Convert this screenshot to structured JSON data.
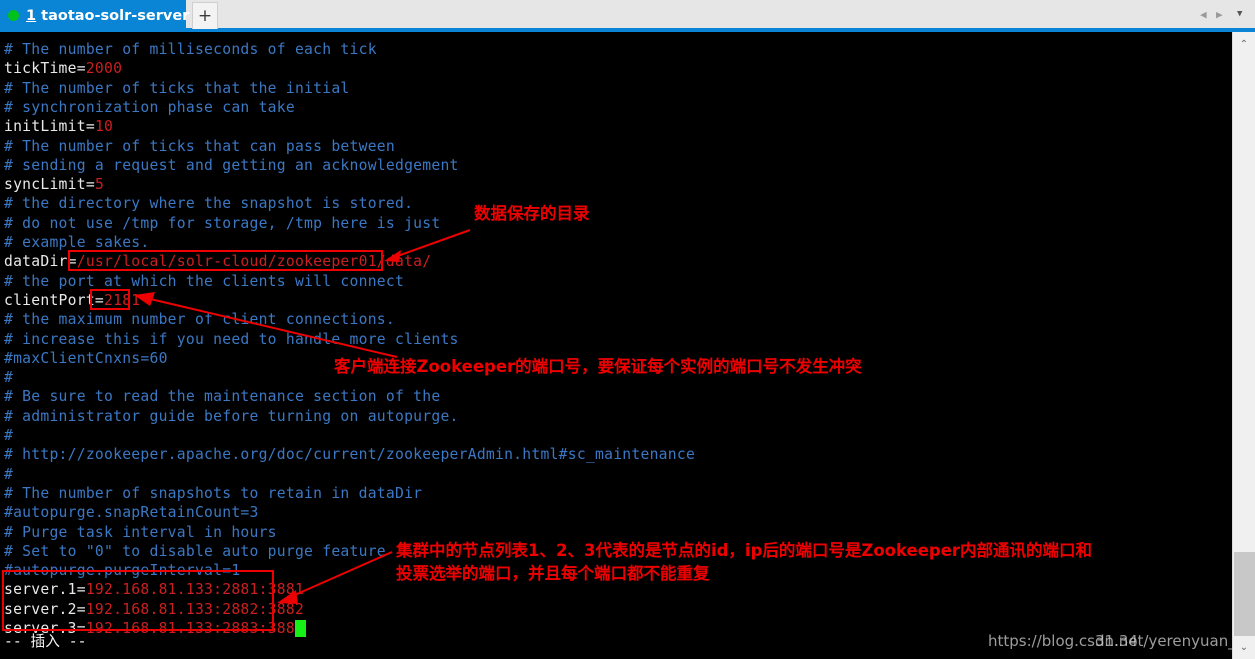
{
  "window": {
    "tab": {
      "index": "1",
      "title": "taotao-solr-server",
      "close_label": "×",
      "status_dot_color": "#00c21c"
    },
    "new_tab_label": "+",
    "controls": {
      "prev": "◀",
      "next": "▶",
      "menu": "▼"
    },
    "accent_color": "#0a84d4"
  },
  "terminal": {
    "background": "#000000",
    "comment_color": "#3b78c4",
    "value_color": "#cc1f1f",
    "text_color": "#e9e9e9",
    "cursor_color": "#16f016",
    "lines": [
      {
        "type": "comment",
        "text": "# The number of milliseconds of each tick"
      },
      {
        "type": "kv",
        "key": "tickTime=",
        "value": "2000"
      },
      {
        "type": "comment",
        "text": "# The number of ticks that the initial"
      },
      {
        "type": "comment",
        "text": "# synchronization phase can take"
      },
      {
        "type": "kv",
        "key": "initLimit=",
        "value": "10"
      },
      {
        "type": "comment",
        "text": "# The number of ticks that can pass between"
      },
      {
        "type": "comment",
        "text": "# sending a request and getting an acknowledgement"
      },
      {
        "type": "kv",
        "key": "syncLimit=",
        "value": "5"
      },
      {
        "type": "comment",
        "text": "# the directory where the snapshot is stored."
      },
      {
        "type": "comment",
        "text": "# do not use /tmp for storage, /tmp here is just"
      },
      {
        "type": "comment",
        "text": "# example sakes."
      },
      {
        "type": "kv",
        "key": "dataDir=",
        "value": "/usr/local/solr-cloud/zookeeper01/data/"
      },
      {
        "type": "comment",
        "text": "# the port at which the clients will connect"
      },
      {
        "type": "kv",
        "key": "clientPort=",
        "value": "2181"
      },
      {
        "type": "comment",
        "text": "# the maximum number of client connections."
      },
      {
        "type": "comment",
        "text": "# increase this if you need to handle more clients"
      },
      {
        "type": "comment",
        "text": "#maxClientCnxns=60"
      },
      {
        "type": "comment",
        "text": "#"
      },
      {
        "type": "comment",
        "text": "# Be sure to read the maintenance section of the"
      },
      {
        "type": "comment",
        "text": "# administrator guide before turning on autopurge."
      },
      {
        "type": "comment",
        "text": "#"
      },
      {
        "type": "comment",
        "text": "# http://zookeeper.apache.org/doc/current/zookeeperAdmin.html#sc_maintenance"
      },
      {
        "type": "comment",
        "text": "#"
      },
      {
        "type": "comment",
        "text": "# The number of snapshots to retain in dataDir"
      },
      {
        "type": "comment",
        "text": "#autopurge.snapRetainCount=3"
      },
      {
        "type": "comment",
        "text": "# Purge task interval in hours"
      },
      {
        "type": "comment",
        "text": "# Set to \"0\" to disable auto purge feature"
      },
      {
        "type": "comment",
        "text": "#autopurge.purgeInterval=1"
      },
      {
        "type": "kv",
        "key": "server.1=",
        "value": "192.168.81.133:2881:3881"
      },
      {
        "type": "kv",
        "key": "server.2=",
        "value": "192.168.81.133:2882:3882"
      },
      {
        "type": "kv",
        "key": "server.3=",
        "value": "192.168.81.133:2883:3883"
      }
    ],
    "status_line": "-- 插入 --"
  },
  "annotations": [
    {
      "id": "datadir-note",
      "text": "数据保存的目录"
    },
    {
      "id": "clientport-note",
      "text": "客户端连接Zookeeper的端口号，要保证每个实例的端口号不发生冲突"
    },
    {
      "id": "servers-note-line1",
      "text": "集群中的节点列表1、2、3代表的是节点的id，ip后的端口号是Zookeeper内部通讯的端口和"
    },
    {
      "id": "servers-note-line2",
      "text": "投票选举的端口，并且每个端口都不能重复"
    }
  ],
  "annotation_color": "#ee0000",
  "watermark": {
    "url": "https://blog.csdn.net/yerenyuan_pku",
    "overlap": "31.34"
  },
  "scrollbar": {
    "up_arrow": "⌃",
    "down_arrow": "⌄"
  }
}
